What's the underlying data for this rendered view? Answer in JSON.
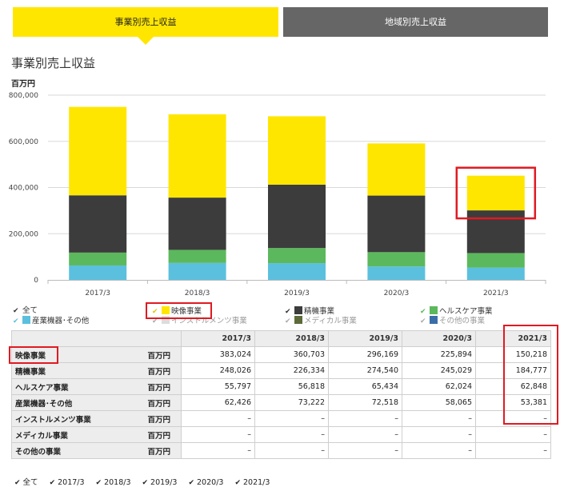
{
  "tabs": [
    {
      "label": "事業別売上収益",
      "active": true
    },
    {
      "label": "地域別売上収益",
      "active": false
    }
  ],
  "title": "事業別売上収益",
  "unit": "百万円",
  "chart_data": {
    "type": "bar",
    "stacked": true,
    "categories": [
      "2017/3",
      "2018/3",
      "2019/3",
      "2020/3",
      "2021/3"
    ],
    "ylim": [
      0,
      800000
    ],
    "yticks": [
      "0",
      "200,000",
      "400,000",
      "600,000",
      "800,000"
    ],
    "ytick_values": [
      0,
      200000,
      400000,
      600000,
      800000
    ],
    "series": [
      {
        "name": "産業機器･その他",
        "color": "#5bc0de",
        "values": [
          62426,
          73222,
          72518,
          58065,
          53381
        ]
      },
      {
        "name": "ヘルスケア事業",
        "color": "#5cb85c",
        "values": [
          55797,
          56818,
          65434,
          62024,
          62848
        ]
      },
      {
        "name": "精機事業",
        "color": "#3c3c3c",
        "values": [
          248026,
          226334,
          274540,
          245029,
          184777
        ]
      },
      {
        "name": "映像事業",
        "color": "#ffe600",
        "values": [
          383024,
          360703,
          296169,
          225894,
          150218
        ]
      }
    ]
  },
  "legend": [
    {
      "label": "全て",
      "swatch": "",
      "muted": false
    },
    {
      "label": "映像事業",
      "swatch": "#ffe600",
      "muted": false
    },
    {
      "label": "精機事業",
      "swatch": "#3c3c3c",
      "muted": false
    },
    {
      "label": "ヘルスケア事業",
      "swatch": "#5cb85c",
      "muted": false
    },
    {
      "label": "産業機器･その他",
      "swatch": "#5bc0de",
      "muted": false
    },
    {
      "label": "インストルメンツ事業",
      "swatch": "#dddddd",
      "muted": true
    },
    {
      "label": "メディカル事業",
      "swatch": "#5d6b3a",
      "muted": true
    },
    {
      "label": "その他の事業",
      "swatch": "#3b6ea8",
      "muted": true
    }
  ],
  "table": {
    "columns": [
      "2017/3",
      "2018/3",
      "2019/3",
      "2020/3",
      "2021/3"
    ],
    "rows": [
      {
        "name": "映像事業",
        "unit": "百万円",
        "values": [
          "383,024",
          "360,703",
          "296,169",
          "225,894",
          "150,218"
        ]
      },
      {
        "name": "精機事業",
        "unit": "百万円",
        "values": [
          "248,026",
          "226,334",
          "274,540",
          "245,029",
          "184,777"
        ]
      },
      {
        "name": "ヘルスケア事業",
        "unit": "百万円",
        "values": [
          "55,797",
          "56,818",
          "65,434",
          "62,024",
          "62,848"
        ]
      },
      {
        "name": "産業機器･その他",
        "unit": "百万円",
        "values": [
          "62,426",
          "73,222",
          "72,518",
          "58,065",
          "53,381"
        ]
      },
      {
        "name": "インストルメンツ事業",
        "unit": "百万円",
        "values": [
          "–",
          "–",
          "–",
          "–",
          "–"
        ]
      },
      {
        "name": "メディカル事業",
        "unit": "百万円",
        "values": [
          "–",
          "–",
          "–",
          "–",
          "–"
        ]
      },
      {
        "name": "その他の事業",
        "unit": "百万円",
        "values": [
          "–",
          "–",
          "–",
          "–",
          "–"
        ]
      }
    ]
  },
  "bottom_filters": [
    "全て",
    "2017/3",
    "2018/3",
    "2019/3",
    "2020/3",
    "2021/3"
  ],
  "check_glyph": "✔",
  "highlight_color": "#e01a22"
}
